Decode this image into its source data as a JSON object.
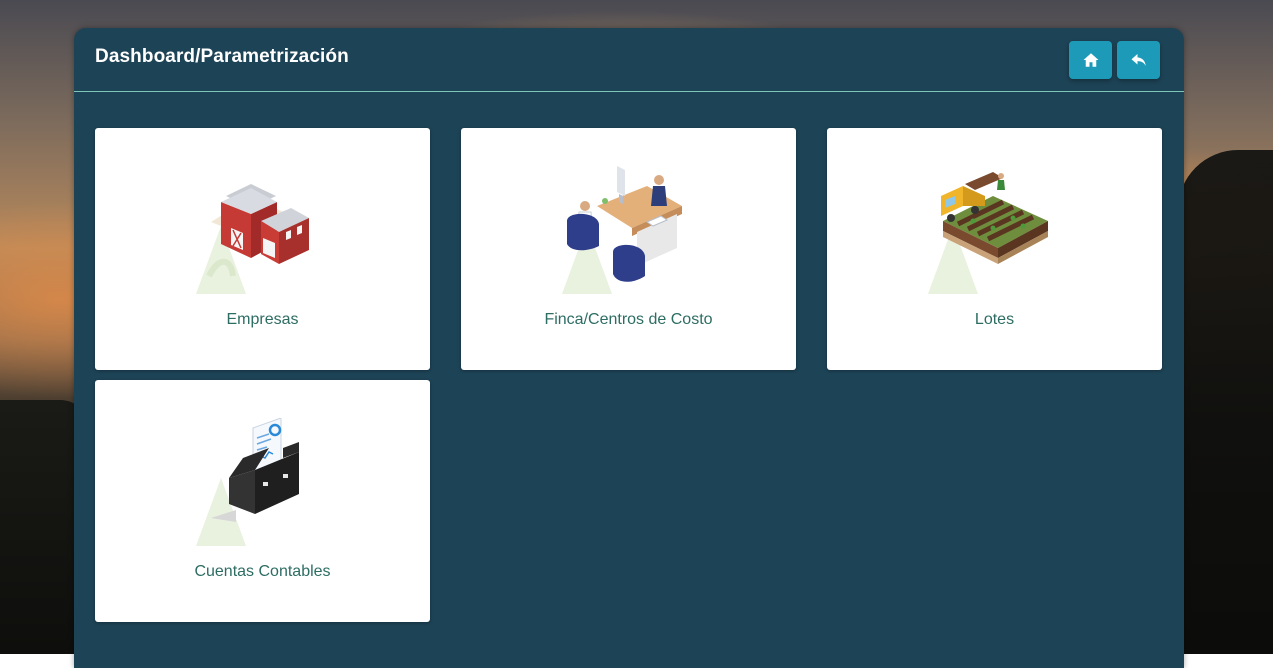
{
  "header": {
    "title": "Dashboard/Parametrización",
    "home_icon": "home-icon",
    "back_icon": "reply-icon",
    "accent": "#1e9ab9"
  },
  "cards": [
    {
      "label": "Empresas",
      "icon": "barn-illustration"
    },
    {
      "label": "Finca/Centros de Costo",
      "icon": "office-desk-illustration"
    },
    {
      "label": "Lotes",
      "icon": "farm-lot-illustration"
    },
    {
      "label": "Cuentas Contables",
      "icon": "accounting-folder-illustration"
    }
  ],
  "colors": {
    "panel": "#1d4356",
    "card_text": "#2d6d63"
  }
}
